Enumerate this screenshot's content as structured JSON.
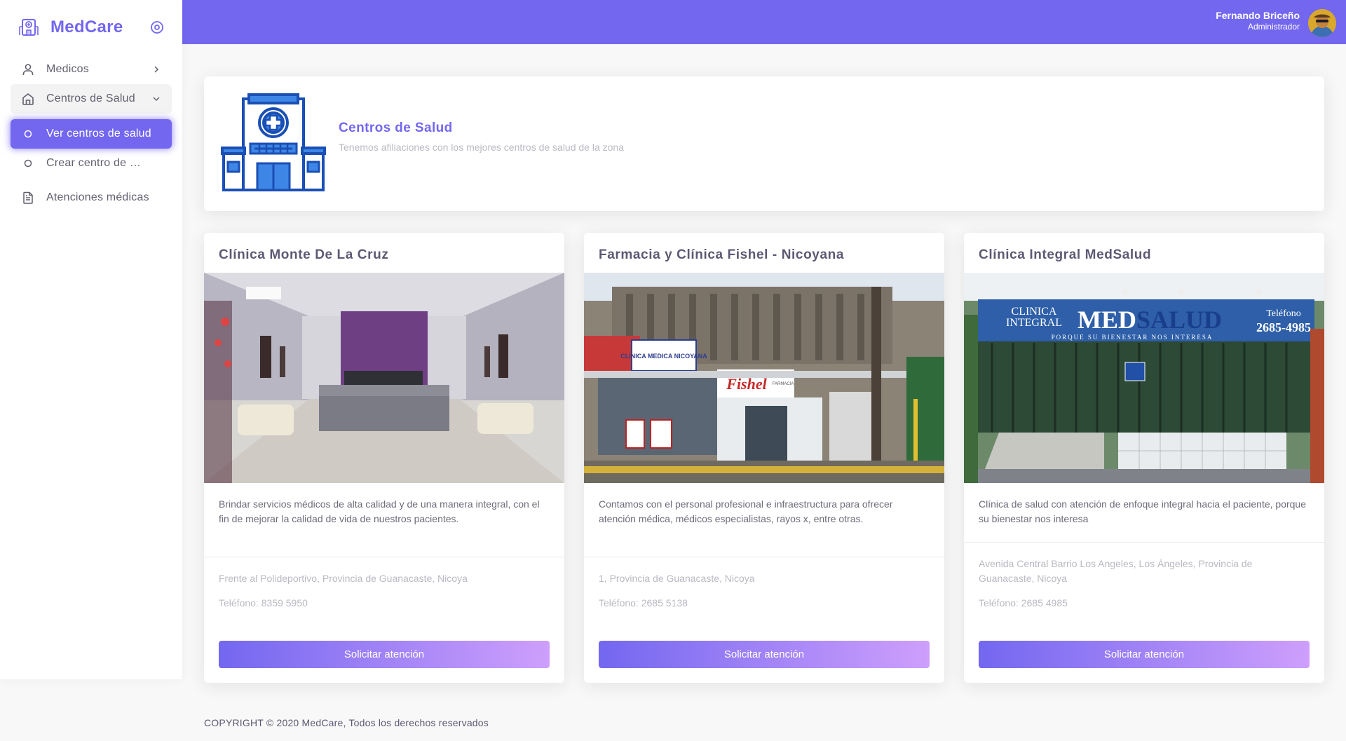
{
  "brand": {
    "name": "MedCare"
  },
  "sidebar": {
    "items": [
      {
        "label": "Medicos"
      },
      {
        "label": "Centros de Salud"
      },
      {
        "label": "Ver centros de salud"
      },
      {
        "label": "Crear centro de salud"
      },
      {
        "label": "Atenciones médicas"
      }
    ]
  },
  "header": {
    "user_name": "Fernando Briceño",
    "user_role": "Administrador"
  },
  "hero": {
    "title": "Centros de Salud",
    "subtitle": "Tenemos afiliaciones con los mejores centros de salud de la zona"
  },
  "cards": [
    {
      "title": "Clínica Monte De La Cruz",
      "description": "Brindar servicios médicos de alta calidad y de una manera integral, con el fin de mejorar la calidad de vida de nuestros pacientes.",
      "address": "Frente al Polideportivo, Provincia de Guanacaste, Nicoya",
      "phone": "Teléfono: 8359 5950",
      "button": "Solicitar atención"
    },
    {
      "title": "Farmacia y Clínica Fishel - Nicoyana",
      "description": "Contamos con el personal profesional e infraestructura para ofrecer atención médica, médicos especialistas, rayos x, entre otras.",
      "address": "1, Provincia de Guanacaste, Nicoya",
      "phone": "Teléfono: 2685 5138",
      "button": "Solicitar atención",
      "photo_signs": {
        "sign1": "CLINICA MEDICA NICOYANA",
        "sign2": "Fishel",
        "sign3": "FARMACIA"
      }
    },
    {
      "title": "Clínica Integral MedSalud",
      "description": "Clínica de salud con atención de enfoque integral hacia el paciente, porque su bienestar nos interesa",
      "address": "Avenida Central Barrio Los Angeles, Los Ángeles, Provincia de Guanacaste, Nicoya",
      "phone": "Teléfono: 2685 4985",
      "button": "Solicitar atención",
      "photo_signs": {
        "clinica": "CLINICA",
        "integral": "INTEGRAL",
        "med": "MED",
        "salud": "SALUD",
        "tel_label": "Teléfono",
        "tel": "2685-4985",
        "tagline": "PORQUE SU BIENESTAR NOS INTERESA"
      }
    }
  ],
  "footer": {
    "text": "COPYRIGHT © 2020 MedCare, Todos los derechos reservados"
  }
}
